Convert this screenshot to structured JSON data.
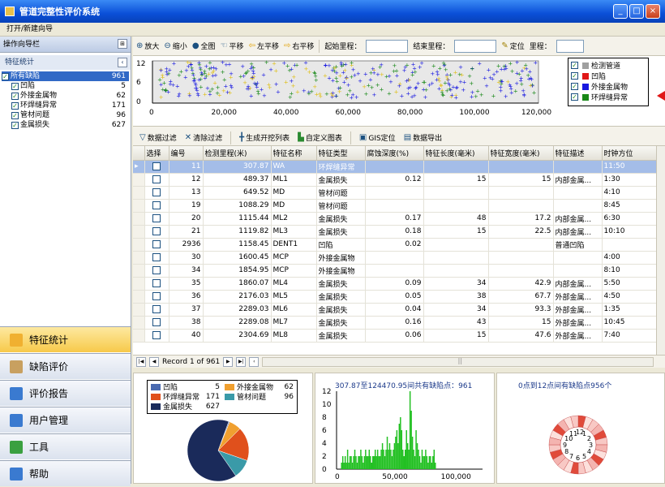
{
  "app": {
    "title": "管道完整性评价系统"
  },
  "menu": {
    "item": "打开/新建向导"
  },
  "nav": {
    "header": "操作向导栏",
    "section": "特征统计",
    "tree": [
      {
        "label": "所有缺陷",
        "count": "961",
        "checked": true,
        "selected": true
      },
      {
        "label": "凹陷",
        "count": "5",
        "checked": true
      },
      {
        "label": "外接金属物",
        "count": "62",
        "checked": true
      },
      {
        "label": "环焊缝异常",
        "count": "171",
        "checked": true
      },
      {
        "label": "管材问题",
        "count": "96",
        "checked": true
      },
      {
        "label": "金属损失",
        "count": "627",
        "checked": true
      }
    ],
    "buttons": [
      {
        "label": "特征统计",
        "icon": "folder-icon",
        "color": "#f0b030"
      },
      {
        "label": "缺陷评价",
        "icon": "check-icon",
        "color": "#c8a060"
      },
      {
        "label": "评价报告",
        "icon": "table-icon",
        "color": "#3a7ad0"
      },
      {
        "label": "用户管理",
        "icon": "users-icon",
        "color": "#3a7ad0"
      },
      {
        "label": "工具",
        "icon": "tool-icon",
        "color": "#3aa040"
      },
      {
        "label": "帮助",
        "icon": "help-icon",
        "color": "#3a7ad0"
      }
    ]
  },
  "toolbar": {
    "zoomin": "放大",
    "zoomout": "缩小",
    "full": "全图",
    "pan": "平移",
    "left": "左平移",
    "right": "右平移",
    "start_label": "起始里程：",
    "end_label": "结束里程：",
    "locate": "定位",
    "mileage_label": "里程："
  },
  "scatter": {
    "yticks": [
      "12",
      "6",
      "0"
    ],
    "xticks": [
      "0",
      "20,000",
      "40,000",
      "60,000",
      "80,000",
      "100,000",
      "120,000"
    ],
    "legend": [
      {
        "label": "检测管道",
        "color": "#a0a0a0"
      },
      {
        "label": "凹陷",
        "color": "#e01818"
      },
      {
        "label": "外接金属物",
        "color": "#1818e0"
      },
      {
        "label": "环焊缝异常",
        "color": "#188818"
      }
    ]
  },
  "gridtb": {
    "filter": "数据过滤",
    "clear": "清除过滤",
    "gen": "生成开挖列表",
    "custom": "自定义图表",
    "gis": "GIS定位",
    "export": "数据导出"
  },
  "table": {
    "headers": [
      "选择",
      "编号",
      "检测里程(米)",
      "特征名称",
      "特征类型",
      "腐蚀深度(%)",
      "特征长度(毫米)",
      "特征宽度(毫米)",
      "特征描述",
      "时钟方位"
    ],
    "rows": [
      [
        "",
        "11",
        "307.87",
        "WA",
        "环焊缝异常",
        "",
        "",
        "",
        "",
        "11:50"
      ],
      [
        "",
        "12",
        "489.37",
        "ML1",
        "金属损失",
        "0.12",
        "15",
        "15",
        "内部金属...",
        "1:30"
      ],
      [
        "",
        "13",
        "649.52",
        "MD",
        "管材问题",
        "",
        "",
        "",
        "",
        "4:10"
      ],
      [
        "",
        "19",
        "1088.29",
        "MD",
        "管材问题",
        "",
        "",
        "",
        "",
        "8:45"
      ],
      [
        "",
        "20",
        "1115.44",
        "ML2",
        "金属损失",
        "0.17",
        "48",
        "17.2",
        "内部金属...",
        "6:30"
      ],
      [
        "",
        "21",
        "1119.82",
        "ML3",
        "金属损失",
        "0.18",
        "15",
        "22.5",
        "内部金属...",
        "10:10"
      ],
      [
        "",
        "2936",
        "1158.45",
        "DENT1",
        "凹陷",
        "0.02",
        "",
        "",
        "普通凹陷",
        ""
      ],
      [
        "",
        "30",
        "1600.45",
        "MCP",
        "外接金属物",
        "",
        "",
        "",
        "",
        "4:00"
      ],
      [
        "",
        "34",
        "1854.95",
        "MCP",
        "外接金属物",
        "",
        "",
        "",
        "",
        "8:10"
      ],
      [
        "",
        "35",
        "1860.07",
        "ML4",
        "金属损失",
        "0.09",
        "34",
        "42.9",
        "内部金属...",
        "5:50"
      ],
      [
        "",
        "36",
        "2176.03",
        "ML5",
        "金属损失",
        "0.05",
        "38",
        "67.7",
        "外部金属...",
        "4:50"
      ],
      [
        "",
        "37",
        "2289.03",
        "ML6",
        "金属损失",
        "0.04",
        "34",
        "93.3",
        "外部金属...",
        "1:35"
      ],
      [
        "",
        "38",
        "2289.08",
        "ML7",
        "金属损失",
        "0.16",
        "43",
        "15",
        "外部金属...",
        "10:45"
      ],
      [
        "",
        "40",
        "2304.69",
        "ML8",
        "金属损失",
        "0.06",
        "15",
        "47.6",
        "外部金属...",
        "7:40"
      ]
    ]
  },
  "pager": {
    "record": "Record 1 of 961"
  },
  "pie": {
    "legend": [
      {
        "label": "凹陷",
        "count": "5",
        "color": "#4a6ab0"
      },
      {
        "label": "外接金属物",
        "count": "62",
        "color": "#f0a030"
      },
      {
        "label": "环焊缝异常",
        "count": "171",
        "color": "#e0501c"
      },
      {
        "label": "管材问题",
        "count": "96",
        "color": "#3a9aa8"
      },
      {
        "label": "金属损失",
        "count": "627",
        "color": "#1a2a5a"
      }
    ]
  },
  "hist": {
    "caption": "307.87至124470.95间共有缺陷点：961",
    "yticks": [
      "12",
      "10",
      "8",
      "6",
      "4",
      "2",
      "0"
    ],
    "xticks": [
      "0",
      "50,000",
      "100,000"
    ]
  },
  "clock": {
    "caption": "0点到12点间有缺陷点956个"
  },
  "chart_data": [
    {
      "type": "pie",
      "categories": [
        "凹陷",
        "外接金属物",
        "环焊缝异常",
        "管材问题",
        "金属损失"
      ],
      "values": [
        5,
        62,
        171,
        96,
        627
      ]
    },
    {
      "type": "bar",
      "title": "307.87至124470.95间共有缺陷点：961",
      "ylim": [
        0,
        12
      ],
      "values": [
        0,
        1,
        2,
        1,
        2,
        1,
        3,
        1,
        2,
        2,
        1,
        2,
        3,
        2,
        1,
        2,
        2,
        3,
        2,
        1,
        2,
        3,
        2,
        2,
        3,
        2,
        1,
        2,
        2,
        3,
        2,
        3,
        2,
        2,
        3,
        4,
        3,
        2,
        3,
        5,
        3,
        4,
        3,
        2,
        3,
        4,
        5,
        6,
        4,
        7,
        8,
        6,
        3,
        2,
        3,
        6,
        4,
        3,
        12,
        9,
        5,
        3,
        2,
        6,
        4,
        3,
        2,
        1,
        3,
        2,
        2,
        3,
        2,
        1,
        2,
        2,
        1,
        2,
        3,
        1,
        0
      ]
    }
  ]
}
